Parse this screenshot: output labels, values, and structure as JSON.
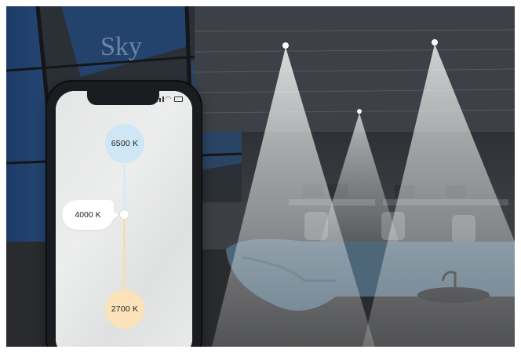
{
  "scene": {
    "sign_text": "Sky"
  },
  "phone": {
    "cool_temp": "6500 K",
    "current_temp": "4000 K",
    "warm_temp": "2700 K"
  },
  "colors": {
    "cool": "#cfe7f4",
    "warm": "#fbe2ba",
    "accent_track_cool": "#d7ebf4",
    "accent_track_warm": "#f5ddb4"
  },
  "icons": [
    "signal-icon",
    "wifi-icon",
    "battery-icon",
    "ceiling-light-icon"
  ]
}
